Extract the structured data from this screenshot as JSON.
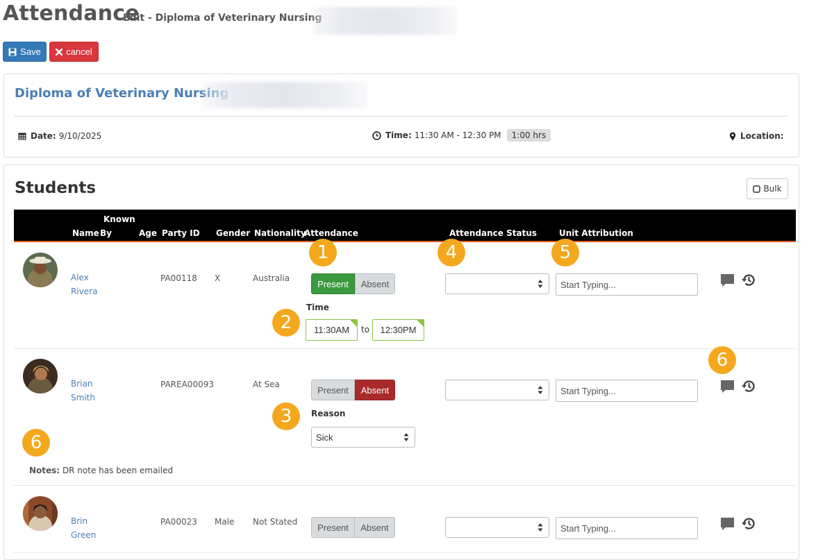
{
  "header": {
    "title": "Attendance",
    "subtitle": "Edit - Diploma of Veterinary Nursing",
    "save_label": "Save",
    "cancel_label": "cancel"
  },
  "session": {
    "course_title": "Diploma of Veterinary Nursing",
    "date_label": "Date:",
    "date_value": "9/10/2025",
    "time_label": "Time:",
    "time_value": "11:30 AM - 12:30 PM",
    "duration": "1:00 hrs",
    "location_label": "Location:"
  },
  "students_section": {
    "heading": "Students",
    "bulk_label": "Bulk",
    "columns": {
      "name": "Name",
      "known_by_1": "Known",
      "known_by_2": "By",
      "age": "Age",
      "party_id": "Party ID",
      "gender": "Gender",
      "nationality": "Nationality",
      "attendance": "Attendance",
      "attendance_status": "Attendance Status",
      "unit_attribution": "Unit Attribution"
    }
  },
  "students": [
    {
      "first": "Alex",
      "last": "Rivera",
      "party_id": "PA00118",
      "gender": "X",
      "nationality": "Australia",
      "present": "Present",
      "absent": "Absent",
      "selected": "present",
      "status_value": "",
      "unit_placeholder": "Start Typing...",
      "time_label": "Time",
      "time_from": "11:30AM",
      "time_to_word": "to",
      "time_to": "12:30PM"
    },
    {
      "first": "Brian",
      "last": "Smith",
      "party_id": "PAREA00093",
      "gender": "",
      "nationality": "At Sea",
      "present": "Present",
      "absent": "Absent",
      "selected": "absent",
      "status_value": "",
      "unit_placeholder": "Start Typing...",
      "reason_label": "Reason",
      "reason_value": "Sick",
      "notes_label": "Notes:",
      "notes_value": "DR note has been emailed"
    },
    {
      "first": "Brin",
      "last": "Green",
      "party_id": "PA00023",
      "gender": "Male",
      "nationality": "Not Stated",
      "present": "Present",
      "absent": "Absent",
      "selected": "none",
      "status_value": "",
      "unit_placeholder": "Start Typing..."
    }
  ],
  "markers": [
    "1",
    "2",
    "3",
    "4",
    "5",
    "6",
    "6"
  ],
  "colors": {
    "primary": "#337ab7",
    "danger": "#d9363e",
    "present_green": "#3b9a3f",
    "absent_red": "#a92a2a",
    "marker_orange": "#f4a81d",
    "header_accent": "#e05a1a"
  },
  "icons": [
    "save-icon",
    "close-icon",
    "calendar-icon",
    "clock-icon",
    "map-pin-icon",
    "checkbox-icon",
    "comment-icon",
    "history-icon"
  ]
}
